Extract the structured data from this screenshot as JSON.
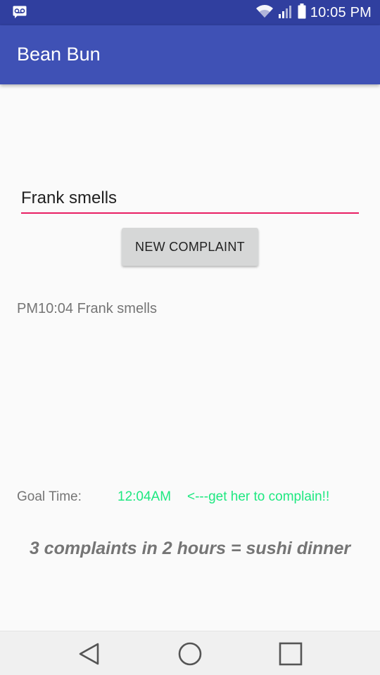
{
  "status_bar": {
    "time": "10:05 PM",
    "icons": [
      "voicemail-icon",
      "wifi-icon",
      "signal-icon",
      "battery-icon"
    ]
  },
  "app_bar": {
    "title": "Bean Bun",
    "color": "#3f51b5",
    "status_color": "#303f9f"
  },
  "complaint_input": {
    "value": "Frank smells",
    "underline_color": "#e91e63"
  },
  "new_complaint_button": {
    "label": "NEW COMPLAINT"
  },
  "complaint_log": {
    "entries": [
      "PM10:04 Frank smells"
    ]
  },
  "goal": {
    "label": "Goal Time:",
    "time": "12:04AM",
    "note": "<---get her to complain!!",
    "accent_color": "#1ee880"
  },
  "reward": {
    "text": "3 complaints in 2 hours = sushi dinner"
  },
  "nav_bar": {
    "buttons": [
      "back-icon",
      "home-icon",
      "recents-icon"
    ]
  }
}
